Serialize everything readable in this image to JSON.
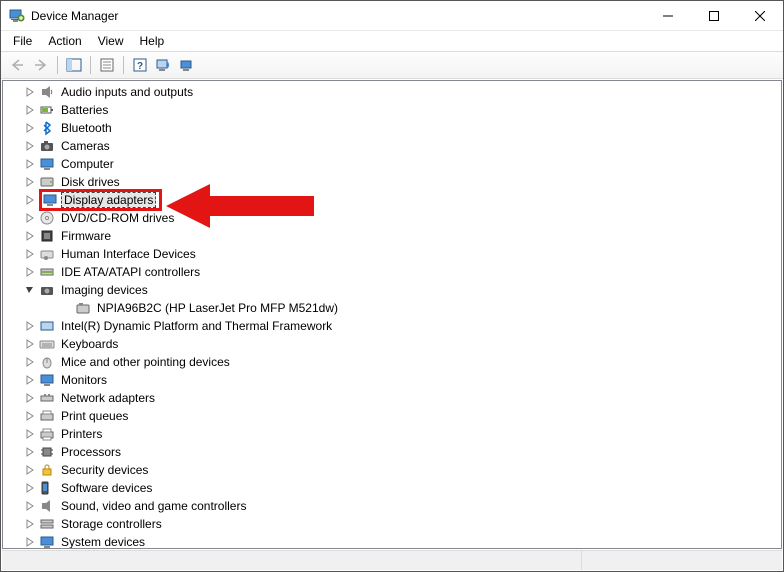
{
  "window": {
    "title": "Device Manager"
  },
  "menu": {
    "file": "File",
    "action": "Action",
    "view": "View",
    "help": "Help"
  },
  "tree": {
    "items": [
      {
        "label": "Audio inputs and outputs",
        "expandable": true,
        "expanded": false
      },
      {
        "label": "Batteries",
        "expandable": true,
        "expanded": false
      },
      {
        "label": "Bluetooth",
        "expandable": true,
        "expanded": false
      },
      {
        "label": "Cameras",
        "expandable": true,
        "expanded": false
      },
      {
        "label": "Computer",
        "expandable": true,
        "expanded": false
      },
      {
        "label": "Disk drives",
        "expandable": true,
        "expanded": false
      },
      {
        "label": "Display adapters",
        "expandable": true,
        "expanded": false,
        "selected": true,
        "highlight": true
      },
      {
        "label": "DVD/CD-ROM drives",
        "expandable": true,
        "expanded": false
      },
      {
        "label": "Firmware",
        "expandable": true,
        "expanded": false
      },
      {
        "label": "Human Interface Devices",
        "expandable": true,
        "expanded": false
      },
      {
        "label": "IDE ATA/ATAPI controllers",
        "expandable": true,
        "expanded": false
      },
      {
        "label": "Imaging devices",
        "expandable": true,
        "expanded": true,
        "children": [
          {
            "label": "NPIA96B2C (HP LaserJet Pro MFP M521dw)"
          }
        ]
      },
      {
        "label": "Intel(R) Dynamic Platform and Thermal Framework",
        "expandable": true,
        "expanded": false
      },
      {
        "label": "Keyboards",
        "expandable": true,
        "expanded": false
      },
      {
        "label": "Mice and other pointing devices",
        "expandable": true,
        "expanded": false
      },
      {
        "label": "Monitors",
        "expandable": true,
        "expanded": false
      },
      {
        "label": "Network adapters",
        "expandable": true,
        "expanded": false
      },
      {
        "label": "Print queues",
        "expandable": true,
        "expanded": false
      },
      {
        "label": "Printers",
        "expandable": true,
        "expanded": false
      },
      {
        "label": "Processors",
        "expandable": true,
        "expanded": false
      },
      {
        "label": "Security devices",
        "expandable": true,
        "expanded": false
      },
      {
        "label": "Software devices",
        "expandable": true,
        "expanded": false
      },
      {
        "label": "Sound, video and game controllers",
        "expandable": true,
        "expanded": false
      },
      {
        "label": "Storage controllers",
        "expandable": true,
        "expanded": false
      },
      {
        "label": "System devices",
        "expandable": true,
        "expanded": false
      }
    ]
  }
}
